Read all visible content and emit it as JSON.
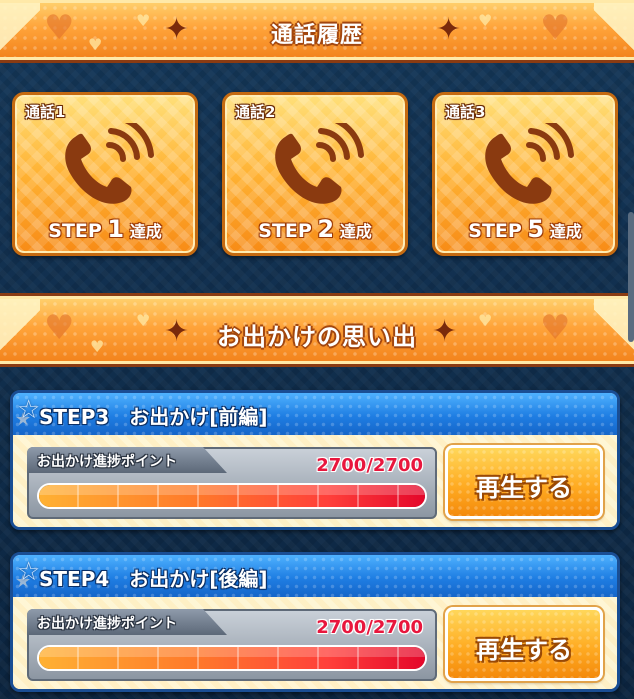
{
  "call_history": {
    "title": "通話履歴",
    "cards": [
      {
        "label": "通話1",
        "step_word": "STEP",
        "step_num": "1",
        "done": "達成"
      },
      {
        "label": "通話2",
        "step_word": "STEP",
        "step_num": "2",
        "done": "達成"
      },
      {
        "label": "通話3",
        "step_word": "STEP",
        "step_num": "5",
        "done": "達成"
      }
    ]
  },
  "outings": {
    "title": "お出かけの思い出",
    "items": [
      {
        "title": "STEP3　お出かけ[前編]",
        "progress_label": "お出かけ進捗ポイント",
        "progress_value": "2700/2700",
        "progress_fraction": 1.0,
        "play_label": "再生する"
      },
      {
        "title": "STEP4　お出かけ[後編]",
        "progress_label": "お出かけ進捗ポイント",
        "progress_value": "2700/2700",
        "progress_fraction": 1.0,
        "play_label": "再生する"
      }
    ]
  },
  "icons": {
    "phone": "phone-ringing-icon",
    "heart": "heart-icon",
    "sparkle": "sparkle-icon",
    "star": "star-icon"
  },
  "colors": {
    "banner_orange": "#ffa43a",
    "card_orange": "#ffb233",
    "phone_brown": "#8a3a10",
    "header_blue": "#1f7ee3",
    "progress_red": "#e4062a",
    "progress_text_red": "#e8163d"
  }
}
